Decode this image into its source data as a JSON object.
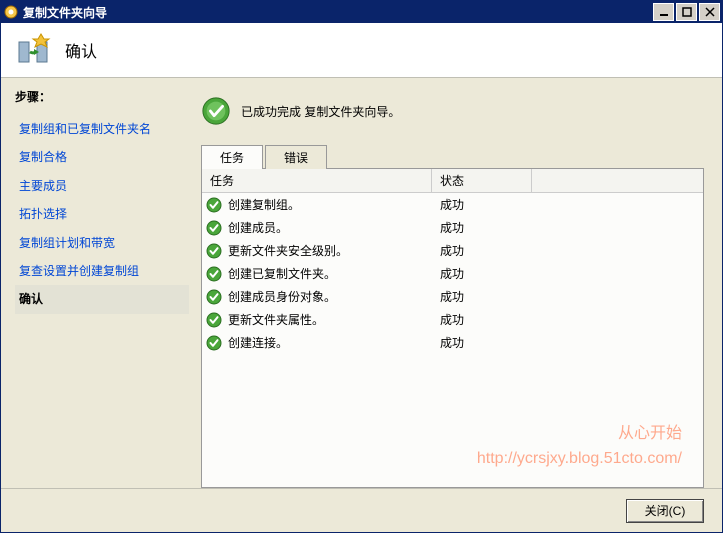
{
  "window": {
    "title": "复制文件夹向导"
  },
  "header": {
    "title": "确认"
  },
  "sidebar": {
    "steps_label": "步骤：",
    "items": [
      {
        "label": "复制组和已复制文件夹名"
      },
      {
        "label": "复制合格"
      },
      {
        "label": "主要成员"
      },
      {
        "label": "拓扑选择"
      },
      {
        "label": "复制组计划和带宽"
      },
      {
        "label": "复查设置并创建复制组"
      },
      {
        "label": "确认"
      }
    ]
  },
  "success": {
    "message": "已成功完成 复制文件夹向导。"
  },
  "tabs": {
    "task_label": "任务",
    "error_label": "错误"
  },
  "columns": {
    "task": "任务",
    "status": "状态"
  },
  "rows": [
    {
      "task": "创建复制组。",
      "status": "成功"
    },
    {
      "task": "创建成员。",
      "status": "成功"
    },
    {
      "task": "更新文件夹安全级别。",
      "status": "成功"
    },
    {
      "task": "创建已复制文件夹。",
      "status": "成功"
    },
    {
      "task": "创建成员身份对象。",
      "status": "成功"
    },
    {
      "task": "更新文件夹属性。",
      "status": "成功"
    },
    {
      "task": "创建连接。",
      "status": "成功"
    }
  ],
  "footer": {
    "close_label": "关闭(C)"
  },
  "watermark": {
    "line1": "从心开始",
    "line2": "http://ycrsjxy.blog.51cto.com/"
  }
}
